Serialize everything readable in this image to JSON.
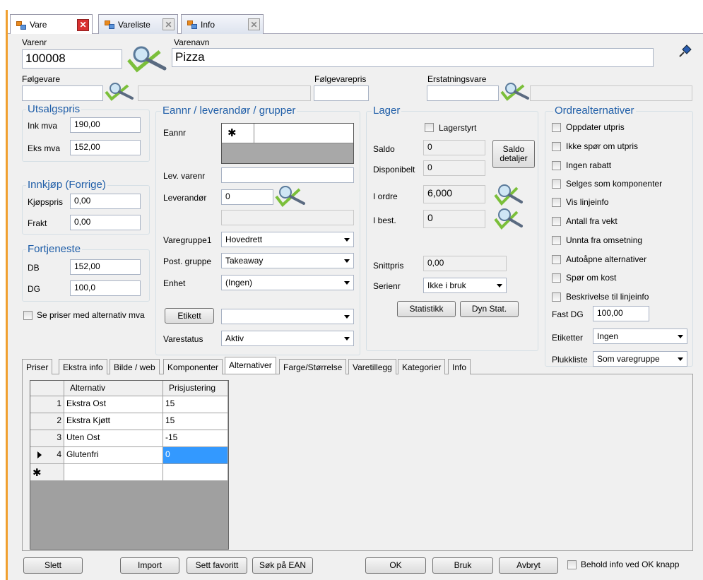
{
  "tabs": [
    {
      "label": "Vare",
      "active": true
    },
    {
      "label": "Vareliste",
      "active": false
    },
    {
      "label": "Info",
      "active": false
    }
  ],
  "header": {
    "varenr_label": "Varenr",
    "varenr_value": "100008",
    "varenavn_label": "Varenavn",
    "varenavn_value": "Pizza",
    "folgevare_label": "Følgevare",
    "folgevare_value": "",
    "folgevare_name": "",
    "folgevarepris_label": "Følgevarepris",
    "folgevarepris_value": "",
    "erstatningsvare_label": "Erstatningsvare",
    "erstatningsvare_value": "",
    "erstatningsvare_name": ""
  },
  "utsalgspris": {
    "title": "Utsalgspris",
    "ink_label": "Ink mva",
    "ink_value": "190,00",
    "eks_label": "Eks mva",
    "eks_value": "152,00"
  },
  "innkjop": {
    "title": "Innkjøp (Forrige)",
    "kjop_label": "Kjøpspris",
    "kjop_value": "0,00",
    "frakt_label": "Frakt",
    "frakt_value": "0,00"
  },
  "fortjeneste": {
    "title": "Fortjeneste",
    "db_label": "DB",
    "db_value": "152,00",
    "dg_label": "DG",
    "dg_value": "100,0"
  },
  "alt_mva_label": "Se priser med alternativ mva",
  "eannr": {
    "title": "Eannr / leverandør / grupper",
    "eannr_label": "Eannr",
    "lev_varenr_label": "Lev. varenr",
    "lev_varenr_value": "",
    "leverandor_label": "Leverandør",
    "leverandor_value": "0",
    "leverandor_name": "",
    "varegruppe_label": "Varegruppe1",
    "varegruppe_value": "Hovedrett",
    "postgruppe_label": "Post. gruppe",
    "postgruppe_value": "Takeaway",
    "enhet_label": "Enhet",
    "enhet_value": "(Ingen)",
    "etikett_button": "Etikett",
    "etikett_value": "",
    "varestatus_label": "Varestatus",
    "varestatus_value": "Aktiv"
  },
  "lager": {
    "title": "Lager",
    "lagerstyrt_label": "Lagerstyrt",
    "saldo_label": "Saldo",
    "saldo_value": "0",
    "disponibelt_label": "Disponibelt",
    "disponibelt_value": "0",
    "saldo_button": "Saldo detaljer",
    "iordre_label": "I ordre",
    "iordre_value": "6,000",
    "ibest_label": "I best.",
    "ibest_value": "0",
    "snittpris_label": "Snittpris",
    "snittpris_value": "0,00",
    "serienr_label": "Serienr",
    "serienr_value": "Ikke i bruk",
    "statistikk_button": "Statistikk",
    "dynstat_button": "Dyn Stat."
  },
  "ordrealt": {
    "title": "Ordrealternativer",
    "options": [
      "Oppdater utpris",
      "Ikke spør om utpris",
      "Ingen rabatt",
      "Selges som komponenter",
      "Vis linjeinfo",
      "Antall fra vekt",
      "Unnta fra omsetning",
      "Autoåpne alternativer",
      "Spør om kost",
      "Beskrivelse til linjeinfo"
    ],
    "fastdg_label": "Fast DG",
    "fastdg_value": "100,00",
    "etiketter_label": "Etiketter",
    "etiketter_value": "Ingen",
    "plukkliste_label": "Plukkliste",
    "plukkliste_value": "Som varegruppe"
  },
  "inner_tabs": [
    "Priser",
    "Ekstra info",
    "Bilde / web",
    "Komponenter",
    "Alternativer",
    "Farge/Størrelse",
    "Varetillegg",
    "Kategorier",
    "Info"
  ],
  "grid": {
    "headers": [
      "Alternativ",
      "Prisjustering"
    ],
    "rows": [
      {
        "n": "1",
        "alt": "Ekstra Ost",
        "pris": "15"
      },
      {
        "n": "2",
        "alt": "Ekstra Kjøtt",
        "pris": "15"
      },
      {
        "n": "3",
        "alt": "Uten Ost",
        "pris": "-15"
      },
      {
        "n": "4",
        "alt": "Glutenfri",
        "pris": "0"
      }
    ],
    "new_row_marker": "✱"
  },
  "bottom": {
    "slett": "Slett",
    "import": "Import",
    "sett_favoritt": "Sett favoritt",
    "sok_ean": "Søk på EAN",
    "ok": "OK",
    "bruk": "Bruk",
    "avbryt": "Avbryt",
    "behold_label": "Behold info ved OK knapp"
  }
}
